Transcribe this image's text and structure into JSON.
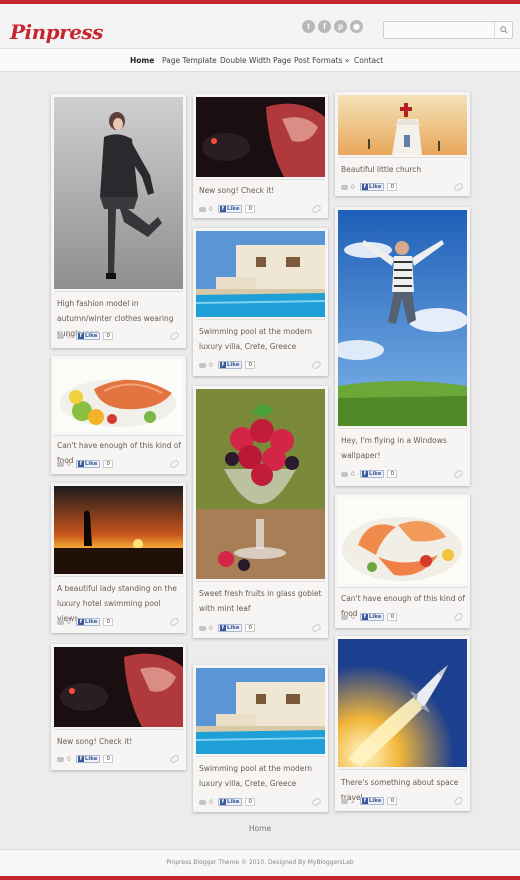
{
  "site": {
    "logo": "Pinpress",
    "home_link": "Home",
    "footer": "Pinpress Blogger Theme © 2010. Designed By MyBloggersLab"
  },
  "social": [
    "t",
    "f",
    "p",
    "rss"
  ],
  "search": {
    "placeholder": ""
  },
  "nav": [
    "Home",
    "Page Template",
    "Double Width Page",
    "Post Formats »",
    "Contact"
  ],
  "like_label": "Like",
  "colors": {
    "accent": "#c8262f",
    "caption": "#6b5a52"
  },
  "posts": [
    {
      "caption": "High fashion model in autumn/winter clothes wearing sunglasses",
      "comments": "0",
      "likes": "0",
      "image": "fashion-model"
    },
    {
      "caption": "Can't have enough of this kind of food",
      "comments": "0",
      "likes": "0",
      "image": "salmon-dish"
    },
    {
      "caption": "A beautiful lady standing on the luxury hotel swimming pool views",
      "comments": "0",
      "likes": "0",
      "image": "sunset-lady"
    },
    {
      "caption": "New song! Check it!",
      "comments": "0",
      "likes": "0",
      "image": "dj-turntable"
    },
    {
      "caption": "New song! Check it!",
      "comments": "0",
      "likes": "0",
      "image": "dj-turntable"
    },
    {
      "caption": "Swimming pool at the modern luxury villa, Crete, Greece",
      "comments": "0",
      "likes": "0",
      "image": "villa-pool"
    },
    {
      "caption": "Sweet fresh fruits in glass goblet with mint leaf",
      "comments": "0",
      "likes": "0",
      "image": "berries-goblet"
    },
    {
      "caption": "Swimming pool at the modern luxury villa, Crete, Greece",
      "comments": "0",
      "likes": "0",
      "image": "villa-pool"
    },
    {
      "caption": "Beautiful little church",
      "comments": "0",
      "likes": "0",
      "image": "white-church"
    },
    {
      "caption": "Hey, I'm flying in a Windows wallpaper!",
      "comments": "0",
      "likes": "0",
      "image": "jumping-man"
    },
    {
      "caption": "Can't have enough of this kind of food",
      "comments": "0",
      "likes": "0",
      "image": "shrimp-dish"
    },
    {
      "caption": "There's something about space travel",
      "comments": "2",
      "likes": "0",
      "image": "rocket-launch"
    }
  ]
}
